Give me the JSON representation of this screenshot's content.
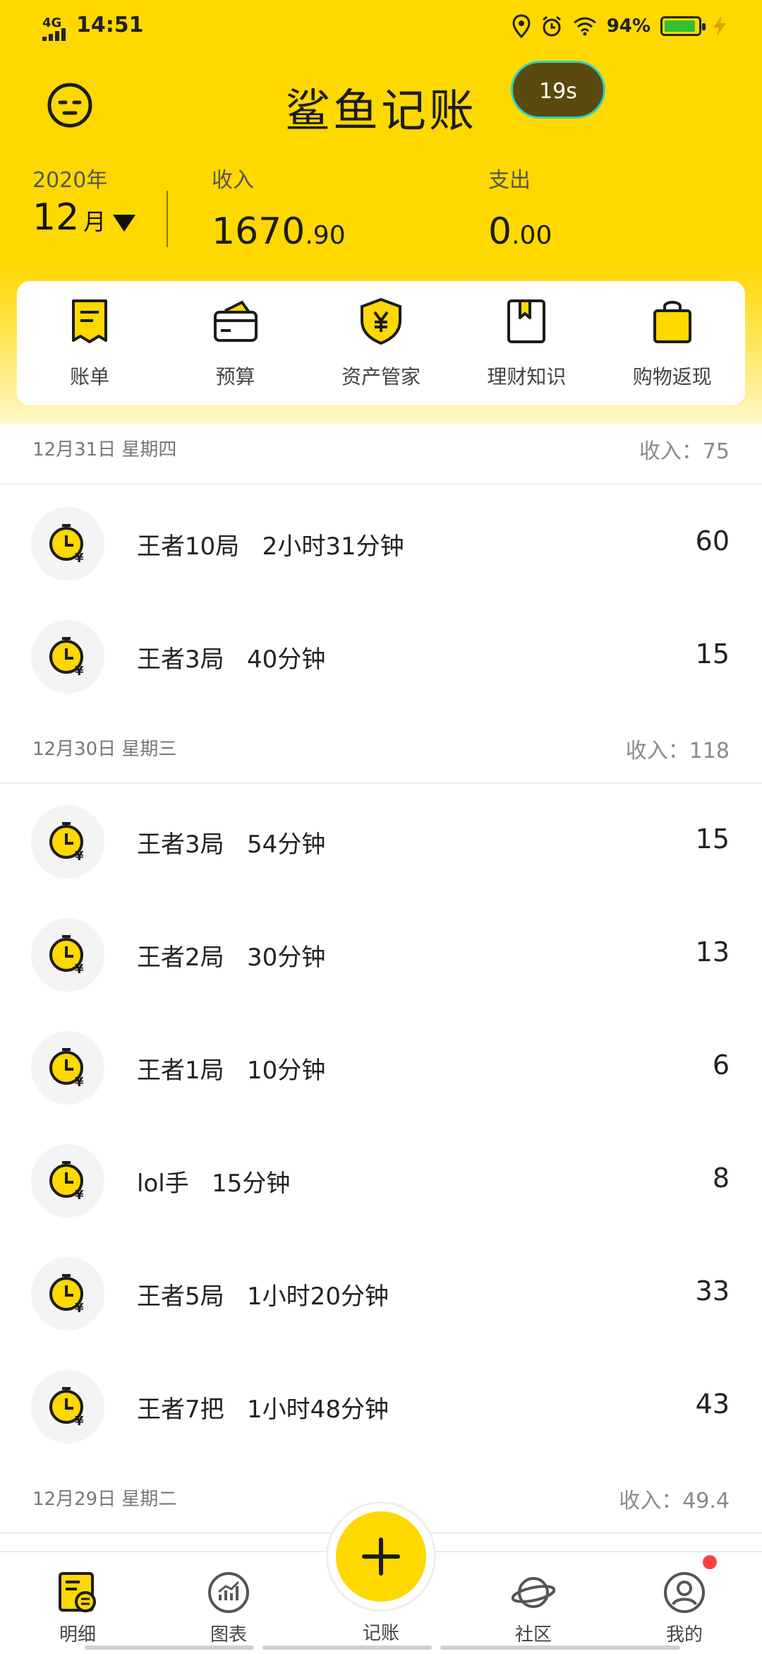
{
  "status_bar": {
    "network": "4G",
    "time": "14:51",
    "battery": "94%",
    "battery_level": 0.94
  },
  "header": {
    "app_title": "鲨鱼记账",
    "timer_badge": "19s",
    "year": "2020年",
    "month": "12",
    "month_unit": "月",
    "income_label": "收入",
    "income_int": "1670",
    "income_dec": ".90",
    "expense_label": "支出",
    "expense_int": "0",
    "expense_dec": ".00"
  },
  "quick_actions": [
    {
      "label": "账单",
      "icon": "bill-icon"
    },
    {
      "label": "预算",
      "icon": "wallet-icon"
    },
    {
      "label": "资产管家",
      "icon": "shield-yen-icon"
    },
    {
      "label": "理财知识",
      "icon": "bookmark-book-icon"
    },
    {
      "label": "购物返现",
      "icon": "shopping-bag-icon"
    }
  ],
  "days": [
    {
      "date": "12月31日  星期四",
      "income": "收入：75",
      "entries": [
        {
          "text": "王者10局   2小时31分钟",
          "amount": "60"
        },
        {
          "text": "王者3局   40分钟",
          "amount": "15"
        }
      ]
    },
    {
      "date": "12月30日  星期三",
      "income": "收入：118",
      "entries": [
        {
          "text": "王者3局   54分钟",
          "amount": "15"
        },
        {
          "text": "王者2局   30分钟",
          "amount": "13"
        },
        {
          "text": "王者1局   10分钟",
          "amount": "6"
        },
        {
          "text": "lol手   15分钟",
          "amount": "8"
        },
        {
          "text": "王者5局   1小时20分钟",
          "amount": "33"
        },
        {
          "text": "王者7把   1小时48分钟",
          "amount": "43"
        }
      ]
    },
    {
      "date": "12月29日  星期二",
      "income": "收入：49.4",
      "entries": []
    }
  ],
  "tab_bar": {
    "tabs": [
      {
        "label": "明细",
        "icon": "detail-icon"
      },
      {
        "label": "图表",
        "icon": "chart-icon"
      },
      {
        "label": "记账",
        "icon": "plus-icon"
      },
      {
        "label": "社区",
        "icon": "planet-icon"
      },
      {
        "label": "我的",
        "icon": "profile-icon"
      }
    ]
  },
  "colors": {
    "brand_yellow": "#ffd800",
    "text_dark": "#222222",
    "muted": "#8a8a8a"
  }
}
